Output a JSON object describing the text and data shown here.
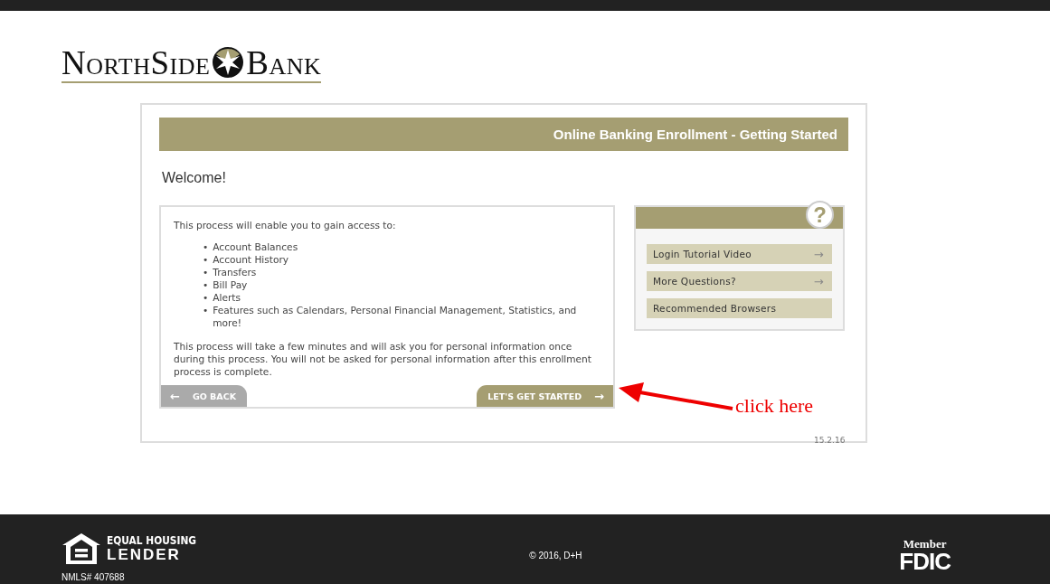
{
  "logo": {
    "left": "NorthSide",
    "right": "Bank"
  },
  "panel": {
    "title": "Online Banking Enrollment - Getting Started",
    "heading": "Welcome!",
    "intro": "This process will enable you to gain access to:",
    "bullet": "•",
    "features": [
      "Account Balances",
      "Account History",
      "Transfers",
      "Bill Pay",
      "Alerts",
      "Features such as Calendars, Personal Financial Management, Statistics, and more!"
    ],
    "note": "This process will take a few minutes and will ask you for personal information once during this process. You will not be asked for personal information after this enrollment process is complete.",
    "back_button": {
      "icon": "←",
      "label": "GO BACK"
    },
    "start_button": {
      "label": "LET'S GET STARTED",
      "icon": "→"
    }
  },
  "help": {
    "icon": "?",
    "links": [
      {
        "label": "Login Tutorial Video",
        "arrow": "→"
      },
      {
        "label": "More Questions?",
        "arrow": "→"
      },
      {
        "label": "Recommended Browsers"
      }
    ]
  },
  "annotation": "click here",
  "version": "15.2.16",
  "footer": {
    "housing_top": "EQUAL HOUSING",
    "housing_bottom": "LENDER",
    "nmls": "NMLS# 407688",
    "copyright": "© 2016, D+H",
    "fdic_top": "Member",
    "fdic_bottom": "FDIC"
  }
}
